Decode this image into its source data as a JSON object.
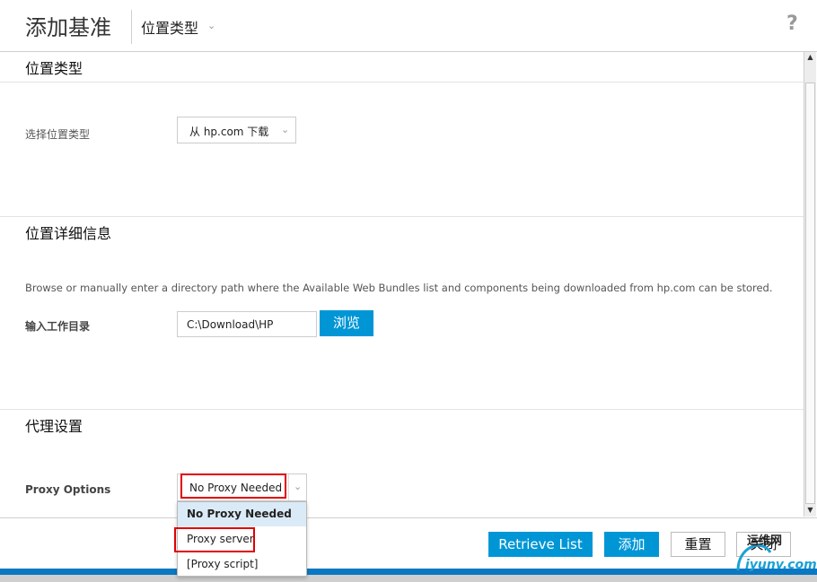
{
  "header": {
    "title": "添加基准",
    "breadcrumb": "位置类型",
    "help_glyph": "?"
  },
  "location_type_section": {
    "heading": "位置类型",
    "select_label": "选择位置类型",
    "select_value": "从 hp.com 下载"
  },
  "location_detail_section": {
    "heading": "位置详细信息",
    "description": "Browse or manually enter a directory path where the Available Web Bundles list and components being downloaded from hp.com can be stored.",
    "dir_label": "输入工作目录",
    "dir_value": "C:\\Download\\HP",
    "browse_label": "浏览"
  },
  "proxy_section": {
    "heading": "代理设置",
    "options_label": "Proxy Options",
    "selected_value": "No Proxy Needed",
    "options": [
      "No Proxy Needed",
      "Proxy server",
      "[Proxy script]"
    ]
  },
  "footer": {
    "retrieve_label": "Retrieve List",
    "add_label": "添加",
    "reset_label": "重置",
    "close_label": "关闭"
  },
  "watermark": {
    "line1": "运维网",
    "line2": "iyunv.com"
  },
  "colors": {
    "accent": "#0096d6",
    "highlight_border": "#e00000",
    "selected_item_bg": "#dbeaf7"
  }
}
